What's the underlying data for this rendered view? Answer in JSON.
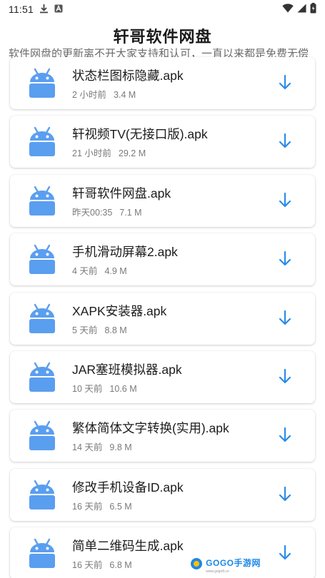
{
  "status_bar": {
    "time": "11:51"
  },
  "header": {
    "title": "轩哥软件网盘",
    "subtitle": "软件网盘的更新离不开大家支持和认可，一直以来都是免费无偿"
  },
  "files": [
    {
      "name": "状态栏图标隐藏.apk",
      "time": "2 小时前",
      "size": "3.4 M"
    },
    {
      "name": "轩视频TV(无接口版).apk",
      "time": "21 小时前",
      "size": "29.2 M"
    },
    {
      "name": "轩哥软件网盘.apk",
      "time": "昨天00:35",
      "size": "7.1 M"
    },
    {
      "name": "手机滑动屏幕2.apk",
      "time": "4 天前",
      "size": "4.9 M"
    },
    {
      "name": "XAPK安装器.apk",
      "time": "5 天前",
      "size": "8.8 M"
    },
    {
      "name": "JAR塞班模拟器.apk",
      "time": "10 天前",
      "size": "10.6 M"
    },
    {
      "name": "繁体简体文字转换(实用).apk",
      "time": "14 天前",
      "size": "9.8 M"
    },
    {
      "name": "修改手机设备ID.apk",
      "time": "16 天前",
      "size": "6.5 M"
    },
    {
      "name": "简单二维码生成.apk",
      "time": "16 天前",
      "size": "6.8 M"
    }
  ],
  "colors": {
    "accent": "#2b8ce8",
    "android": "#5a9ef0"
  },
  "watermark": {
    "logo": "GOGO手游网",
    "url": "www.gogo8.cn"
  }
}
